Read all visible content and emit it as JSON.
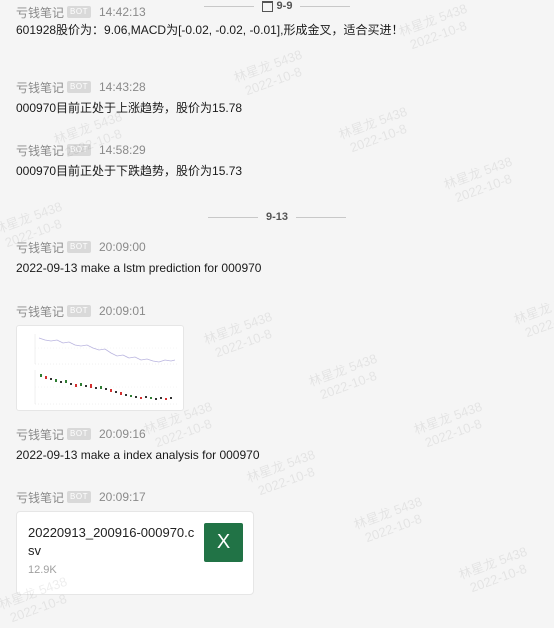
{
  "dividers": [
    {
      "label": "9-9"
    },
    {
      "label": "9-13"
    }
  ],
  "messages": [
    {
      "sender": "亏钱笔记",
      "badge": "BOT",
      "time": "14:42:13",
      "text": "601928股价为：9.06,MACD为[-0.02, -0.02, -0.01],形成金叉，适合买进！"
    },
    {
      "sender": "亏钱笔记",
      "badge": "BOT",
      "time": "14:43:28",
      "text": "000970目前正处于上涨趋势，股价为15.78"
    },
    {
      "sender": "亏钱笔记",
      "badge": "BOT",
      "time": "14:58:29",
      "text": "000970目前正处于下跌趋势，股价为15.73"
    },
    {
      "sender": "亏钱笔记",
      "badge": "BOT",
      "time": "20:09:00",
      "text": "2022-09-13 make a lstm prediction for 000970"
    },
    {
      "sender": "亏钱笔记",
      "badge": "BOT",
      "time": "20:09:01"
    },
    {
      "sender": "亏钱笔记",
      "badge": "BOT",
      "time": "20:09:16",
      "text": "2022-09-13 make a index analysis for 000970"
    },
    {
      "sender": "亏钱笔记",
      "badge": "BOT",
      "time": "20:09:17"
    }
  ],
  "file": {
    "name": "20220913_200916-000970.csv",
    "size": "12.9K",
    "icon_letter": "X",
    "icon_color": "#217346"
  },
  "watermark": {
    "name": "林星龙 5438",
    "date": "2022-10-8"
  }
}
